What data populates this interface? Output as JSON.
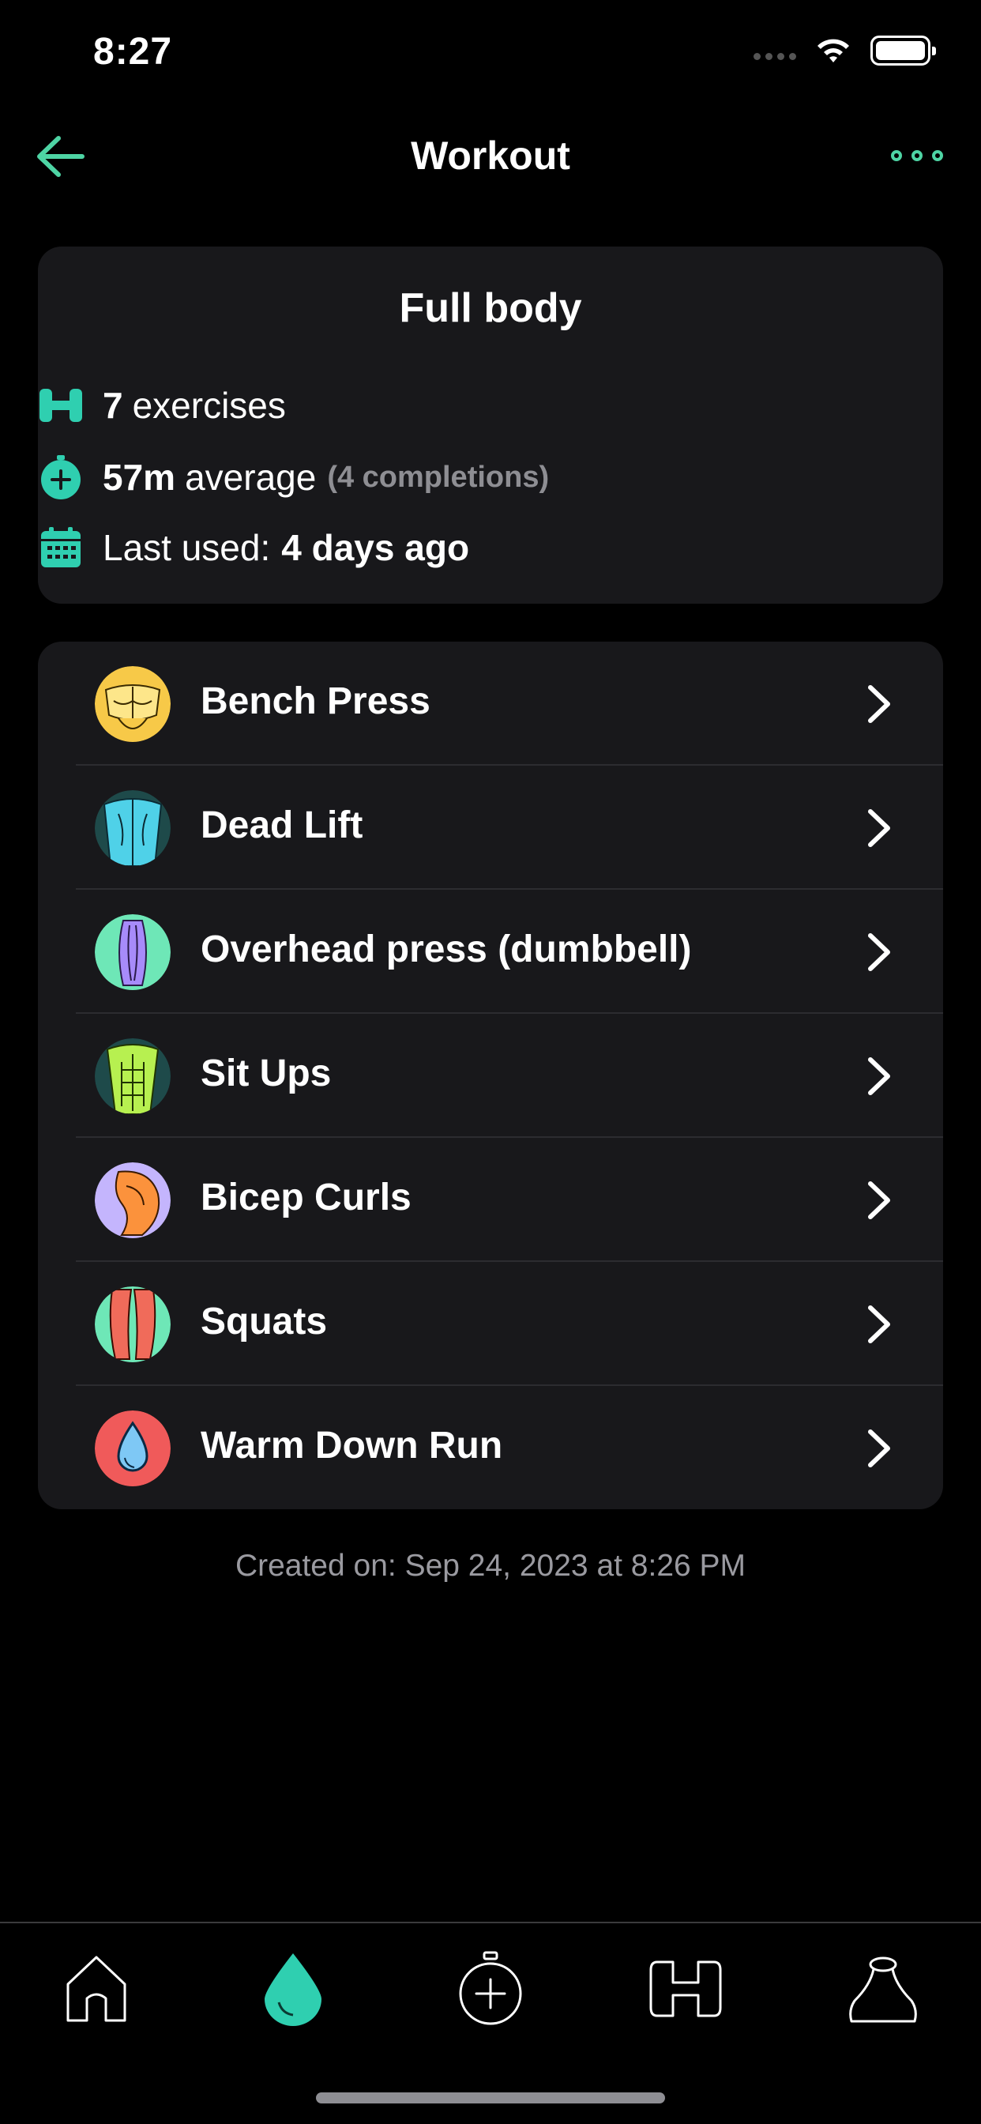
{
  "status_bar": {
    "time": "8:27"
  },
  "nav": {
    "title": "Workout"
  },
  "summary": {
    "title": "Full body",
    "exercises_count": "7",
    "exercises_label": "exercises",
    "average_value": "57m",
    "average_label": "average",
    "completions": "(4 completions)",
    "last_used_label": "Last used:",
    "last_used_value": "4 days ago"
  },
  "exercises": [
    {
      "name": "Bench Press",
      "icon": "chest-muscle-icon",
      "color": "#f7c948"
    },
    {
      "name": "Dead Lift",
      "icon": "back-muscle-icon",
      "color": "#4fd1e8"
    },
    {
      "name": "Overhead press (dumbbell)",
      "icon": "shoulder-muscle-icon",
      "color": "#a78bfa"
    },
    {
      "name": "Sit Ups",
      "icon": "abs-muscle-icon",
      "color": "#b7f050"
    },
    {
      "name": "Bicep Curls",
      "icon": "bicep-muscle-icon",
      "color": "#fb923c"
    },
    {
      "name": "Squats",
      "icon": "legs-muscle-icon",
      "color": "#f06b5a"
    },
    {
      "name": "Warm Down Run",
      "icon": "cardio-drop-icon",
      "color": "#f05a5a"
    }
  ],
  "footer": {
    "created_on": "Created on: Sep 24, 2023 at 8:26 PM"
  },
  "tabs": [
    {
      "name": "home",
      "icon": "home-icon"
    },
    {
      "name": "workouts",
      "icon": "drop-icon",
      "active": true
    },
    {
      "name": "start",
      "icon": "stopwatch-plus-icon"
    },
    {
      "name": "exercises",
      "icon": "dumbbell-icon"
    },
    {
      "name": "profile",
      "icon": "person-icon"
    }
  ],
  "colors": {
    "accent": "#4ed4a4",
    "card": "#18181b",
    "background": "#000000"
  }
}
